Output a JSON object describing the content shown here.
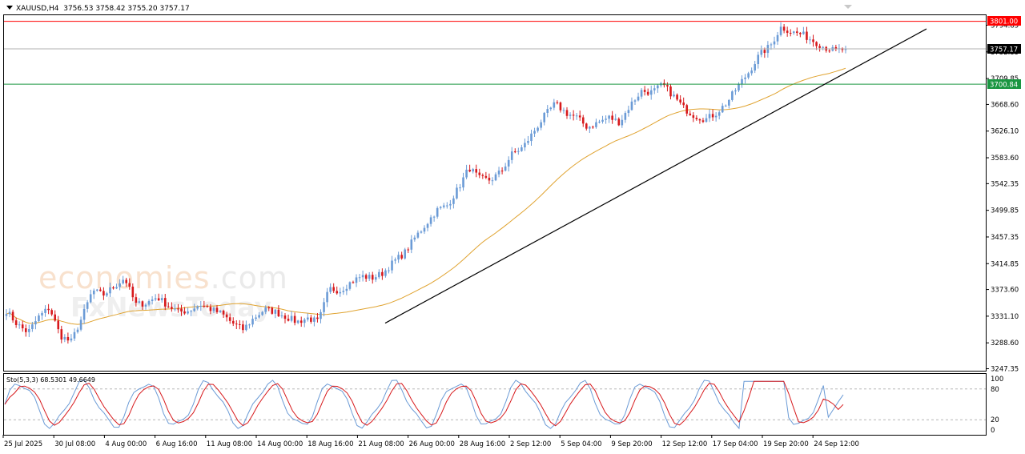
{
  "header": {
    "symbol": "XAUUSD,H4",
    "quote": "3756.53 3758.42 3755.20 3757.17"
  },
  "watermark": {
    "brand_main": "economies",
    "brand_suffix": ".com",
    "brand_secondary": "FxNewsToday"
  },
  "levels": {
    "resistance_label": "3801.00",
    "current_label": "3757.17",
    "support_label": "3700.84",
    "resistance_color": "#ff0000",
    "support_color": "#1a9641",
    "current_color": "#000000"
  },
  "chart_data": [
    {
      "type": "candlestick",
      "symbol": "XAUUSD",
      "timeframe": "H4",
      "price_ticks": [
        "3794.85",
        "3752.35",
        "3709.85",
        "3668.60",
        "3626.10",
        "3583.60",
        "3542.35",
        "3499.85",
        "3457.35",
        "3414.85",
        "3373.60",
        "3331.10",
        "3288.60",
        "3247.35"
      ],
      "ylim": [
        3247.35,
        3810
      ],
      "time_labels": [
        "25 Jul 2025",
        "30 Jul 08:00",
        "4 Aug 00:00",
        "6 Aug 16:00",
        "11 Aug 08:00",
        "14 Aug 00:00",
        "18 Aug 16:00",
        "21 Aug 08:00",
        "26 Aug 00:00",
        "28 Aug 16:00",
        "2 Sep 12:00",
        "5 Sep 04:00",
        "9 Sep 20:00",
        "12 Sep 12:00",
        "17 Sep 04:00",
        "19 Sep 20:00",
        "24 Sep 12:00"
      ],
      "close_anchors": [
        3340,
        3318,
        3305,
        3330,
        3345,
        3300,
        3290,
        3328,
        3372,
        3365,
        3378,
        3392,
        3350,
        3352,
        3362,
        3348,
        3338,
        3340,
        3350,
        3342,
        3335,
        3320,
        3310,
        3328,
        3342,
        3338,
        3330,
        3322,
        3328,
        3322,
        3375,
        3372,
        3385,
        3395,
        3392,
        3400,
        3418,
        3432,
        3457,
        3478,
        3500,
        3508,
        3535,
        3568,
        3550,
        3548,
        3562,
        3590,
        3600,
        3625,
        3650,
        3670,
        3655,
        3648,
        3632,
        3640,
        3648,
        3640,
        3668,
        3690,
        3688,
        3700,
        3682,
        3662,
        3650,
        3645,
        3655,
        3672,
        3698,
        3720,
        3748,
        3762,
        3792,
        3784,
        3780,
        3770,
        3760,
        3754,
        3757
      ],
      "ma_period": 50,
      "ma_color": "#e0a330",
      "up_color": "#6b9bd6",
      "down_color": "#d7191c",
      "horizontal_levels": [
        {
          "price": 3801.0,
          "color": "#ff0000"
        },
        {
          "price": 3757.17,
          "color": "#000000"
        },
        {
          "price": 3700.84,
          "color": "#1a9641"
        }
      ],
      "trendline": {
        "from": {
          "time": "21 Aug 08:00",
          "price": 3320
        },
        "to": {
          "time": "25 Sep",
          "price": 3789
        },
        "color": "#000000"
      }
    },
    {
      "type": "line",
      "indicator": "Stochastic",
      "label": "Sto(5,3,3) 68.5301 49.6649",
      "main_value": 68.5301,
      "signal_value": 49.6649,
      "ylim": [
        0,
        100
      ],
      "levels": [
        20,
        80
      ],
      "ticks": [
        "100",
        "80",
        "20",
        "0"
      ],
      "series": [
        {
          "name": "main",
          "color": "#6b9bd6"
        },
        {
          "name": "signal",
          "color": "#d7191c"
        }
      ]
    }
  ]
}
